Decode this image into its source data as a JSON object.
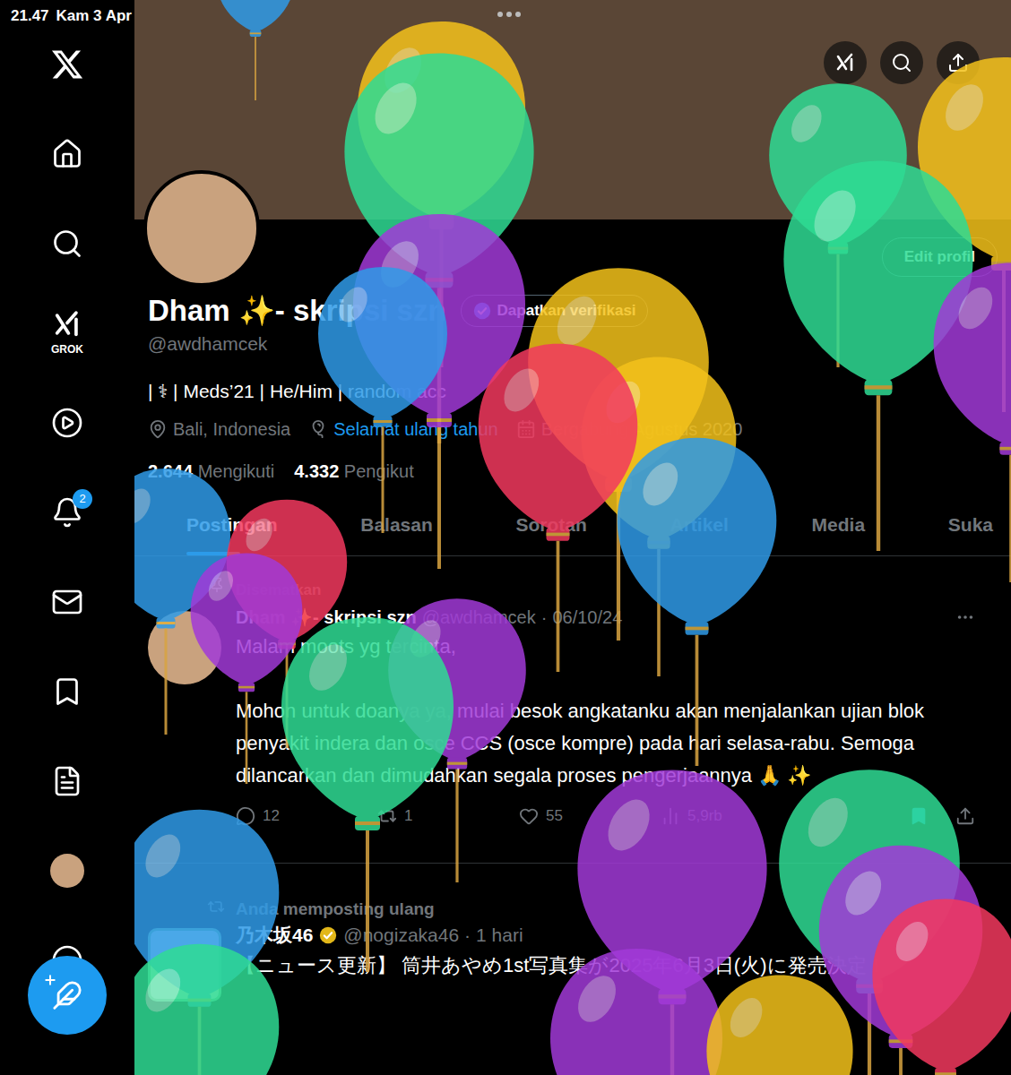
{
  "status_bar": {
    "time": "21.47",
    "date": "Kam 3 Apr"
  },
  "sidebar": {
    "grok_label": "GROK",
    "notification_badge": "2"
  },
  "profile": {
    "name": "Dham ✨- skripsi szn",
    "handle": "@awdhamcek",
    "verify_button": "Dapatkan verifikasi",
    "edit_button": "Edit profil",
    "bio": "| ⚕ | Meds’21 | He/Him | random acc",
    "location": "Bali, Indonesia",
    "birthday": "Selamat ulang tahun",
    "joined": "Bergabung Agustus 2020",
    "following_count": "2.644",
    "following_label": "Mengikuti",
    "followers_count": "4.332",
    "followers_label": "Pengikut"
  },
  "tabs": [
    {
      "label": "Postingan",
      "selected": true
    },
    {
      "label": "Balasan",
      "selected": false
    },
    {
      "label": "Sorotan",
      "selected": false
    },
    {
      "label": "Artikel",
      "selected": false
    },
    {
      "label": "Media",
      "selected": false
    },
    {
      "label": "Suka",
      "selected": false
    }
  ],
  "posts": [
    {
      "kind": "pinned",
      "context": "Disematkan",
      "author": "Dham ✨- skripsi szn",
      "verified": false,
      "handle": "@awdhamcek",
      "separator": "·",
      "time": "06/10/24",
      "text": "Malam moots yg tercinta,\n\nMohon untuk doanya ya, mulai besok angkatanku akan menjalankan ujian blok penyakit indera dan osce CCS (osce kompre) pada hari selasa-rabu. Semoga dilancarkan dan dimudahkan segala proses pengerjaannya 🙏 ✨",
      "replies": "12",
      "reposts": "1",
      "likes": "55",
      "views": "5,9rb",
      "bookmarked": true
    },
    {
      "kind": "repost",
      "context": "Anda memposting ulang",
      "author": "乃木坂46",
      "verified": true,
      "handle": "@nogizaka46",
      "separator": "·",
      "time": "1 hari",
      "text": "【ニュース更新】 筒井あやめ1st写真集が2025年6月3日(火)に発売決定！"
    }
  ],
  "balloons": [
    {
      "color": "#f4c21b"
    },
    {
      "color": "#2f9be8"
    },
    {
      "color": "#2fdc94"
    },
    {
      "color": "#f4c21b"
    },
    {
      "color": "#2fdc94"
    },
    {
      "color": "#2fdc94"
    },
    {
      "color": "#a23ad8"
    },
    {
      "color": "#a23ad8"
    },
    {
      "color": "#2f9be8"
    },
    {
      "color": "#f4c21b"
    },
    {
      "color": "#f4c21b"
    },
    {
      "color": "#f2395f"
    },
    {
      "color": "#2f9be8"
    },
    {
      "color": "#f2395f"
    },
    {
      "color": "#2f9be8"
    },
    {
      "color": "#a23ad8"
    },
    {
      "color": "#a23ad8"
    },
    {
      "color": "#2fdc94"
    },
    {
      "color": "#a23ad8"
    },
    {
      "color": "#2f9be8"
    },
    {
      "color": "#2fdc94"
    },
    {
      "color": "#a23ad8"
    },
    {
      "color": "#f2395f"
    },
    {
      "color": "#a23ad8"
    },
    {
      "color": "#f4c21b"
    },
    {
      "color": "#2fdc94"
    }
  ]
}
